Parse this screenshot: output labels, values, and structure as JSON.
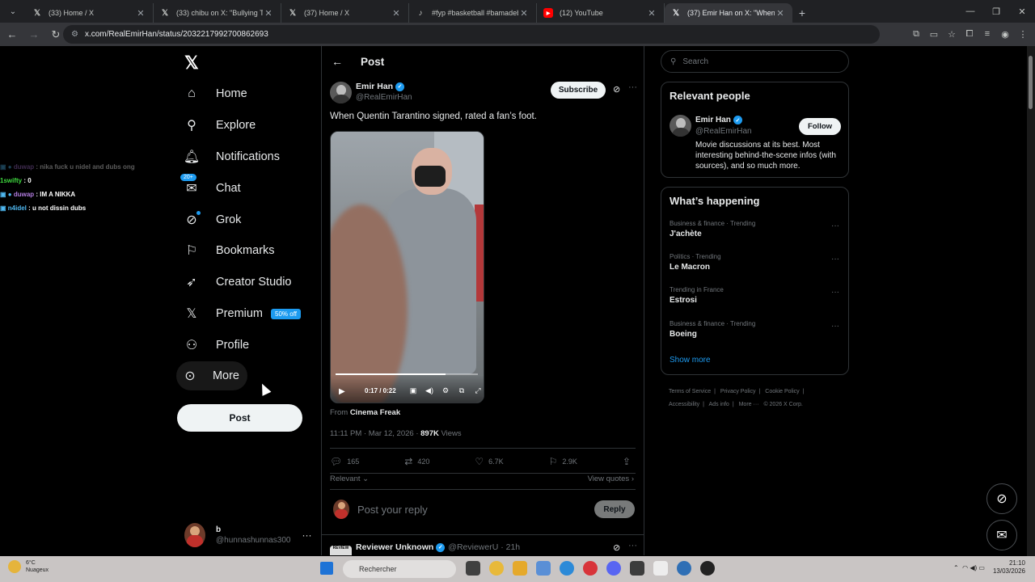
{
  "browser": {
    "tabs": [
      {
        "title": "(33) Home / X",
        "icon": "x-icon",
        "active": false
      },
      {
        "title": "(33) chibu on X: \"Bullying The B",
        "icon": "x-icon",
        "active": false
      },
      {
        "title": "(37) Home / X",
        "icon": "x-icon",
        "active": false
      },
      {
        "title": "#fyp #basketball #bamadebaye",
        "icon": "tiktok-icon",
        "active": false
      },
      {
        "title": "(12) YouTube",
        "icon": "youtube-icon",
        "active": false
      },
      {
        "title": "(37) Emir Han on X: \"When Qu",
        "icon": "x-icon",
        "active": true
      }
    ],
    "url": "x.com/RealEmirHan/status/2032217992700862693"
  },
  "overlay_chat": [
    {
      "user": "duwap",
      "message": "nika fuck u nidel and dubs ong",
      "user_color": "#b27ce0"
    },
    {
      "user": "1swifty",
      "message": "0",
      "user_color": "#3fd93f"
    },
    {
      "user": "duwap",
      "message": "IM A NIKKA",
      "user_color": "#b27ce0"
    },
    {
      "user": "n4idel",
      "message": "u not dissin dubs",
      "user_color": "#4fb8f0"
    }
  ],
  "nav": {
    "items": [
      {
        "label": "Home",
        "icon": "home-icon"
      },
      {
        "label": "Explore",
        "icon": "search-icon"
      },
      {
        "label": "Notifications",
        "icon": "bell-icon"
      },
      {
        "label": "Chat",
        "icon": "chat-icon",
        "badge": "20+"
      },
      {
        "label": "Grok",
        "icon": "grok-icon"
      },
      {
        "label": "Bookmarks",
        "icon": "bookmark-icon"
      },
      {
        "label": "Creator Studio",
        "icon": "rocket-icon"
      },
      {
        "label": "Premium",
        "icon": "x-logo-icon",
        "promo": "50% off"
      },
      {
        "label": "Profile",
        "icon": "person-icon"
      },
      {
        "label": "More",
        "icon": "more-circle-icon"
      }
    ],
    "post_button": "Post",
    "account": {
      "name": "b",
      "handle": "@hunnashunnas300"
    }
  },
  "main": {
    "header": "Post",
    "author": {
      "name": "Emir Han",
      "handle": "@RealEmirHan"
    },
    "subscribe_label": "Subscribe",
    "text": "When Quentin Tarantino signed, rated a fan’s foot.",
    "video": {
      "time": "0:17 / 0:22",
      "progress": 0.77
    },
    "from_prefix": "From",
    "from_source": "Cinema Freak",
    "timestamp": "11:11 PM · Mar 12, 2026 ·",
    "views_count": "897K",
    "views_label": "Views",
    "stats": {
      "replies": "165",
      "reposts": "420",
      "likes": "6.7K",
      "bookmarks": "2.9K"
    },
    "sort_label": "Relevant",
    "view_quotes": "View quotes",
    "reply_placeholder": "Post your reply",
    "reply_button": "Reply",
    "next_post": {
      "name": "Reviewer Unknown",
      "handle": "@ReviewerU · 21h",
      "avatar_text": "REVIEW"
    }
  },
  "sidebar": {
    "search_placeholder": "Search",
    "relevant_title": "Relevant people",
    "person": {
      "name": "Emir Han",
      "handle": "@RealEmirHan",
      "follow_label": "Follow",
      "bio": "Movie discussions at its best. Most interesting behind-the-scene infos (with sources), and so much more."
    },
    "happening_title": "What’s happening",
    "trends": [
      {
        "category": "Business & finance · Trending",
        "name": "J'achète"
      },
      {
        "category": "Politics · Trending",
        "name": "Le Macron"
      },
      {
        "category": "Trending in France",
        "name": "Estrosi"
      },
      {
        "category": "Business & finance · Trending",
        "name": "Boeing"
      }
    ],
    "show_more": "Show more",
    "footer": [
      "Terms of Service",
      "|",
      "Privacy Policy",
      "|",
      "Cookie Policy",
      "|",
      "Accessibility",
      "|",
      "Ads info",
      "|",
      "More ···",
      "© 2026 X Corp."
    ]
  },
  "taskbar": {
    "temp": "6°C",
    "weather": "Nuageux",
    "search": "Rechercher",
    "time": "21:10",
    "date": "13/03/2026"
  },
  "colors": {
    "accent": "#1d9bf0",
    "background": "#000000",
    "border": "#2f3336",
    "muted": "#71767b"
  }
}
